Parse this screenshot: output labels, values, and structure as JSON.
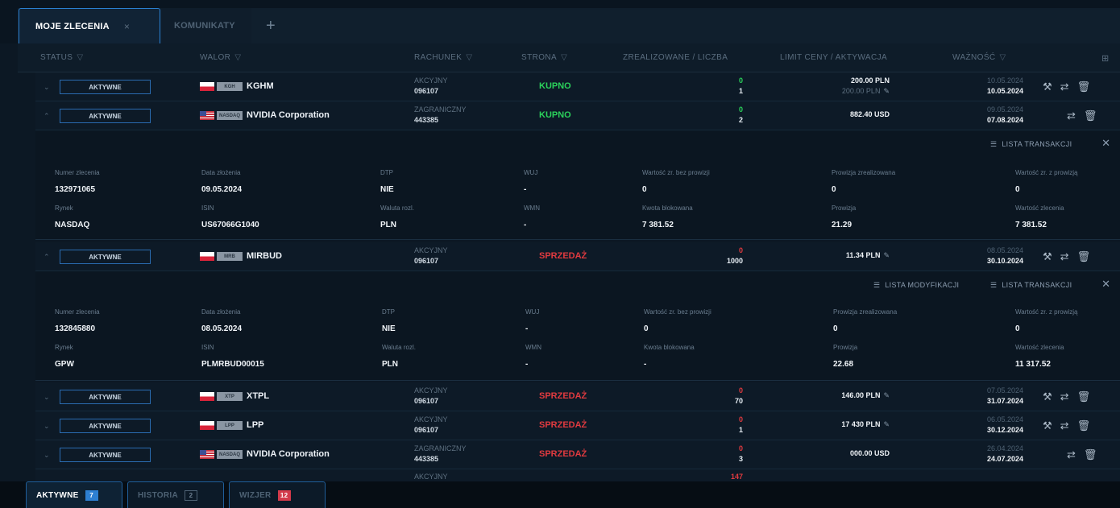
{
  "top_tabs": {
    "active": "MOJE ZLECENIA",
    "close": "×",
    "second": "KOMUNIKATY",
    "plus": "+"
  },
  "columns": {
    "status": "STATUS",
    "walor": "WALOR",
    "rachunek": "RACHUNEK",
    "strona": "STRONA",
    "zrealizowane": "ZREALIZOWANE / LICZBA",
    "limit": "LIMIT CENY / AKTYWACJA",
    "waznosc": "WAŻNOŚĆ",
    "filter_icon": "▽"
  },
  "rows": [
    {
      "status": "AKTYWNE",
      "market": "KGH",
      "name": "KGHM",
      "acc_type": "AKCYJNY",
      "acc_no": "096107",
      "side": "KUPNO",
      "done": "0",
      "qty": "1",
      "limit": "200.00 PLN",
      "limit_sub": "200.00 PLN",
      "valid_from": "10.05.2024",
      "valid_to": "10.05.2024"
    },
    {
      "status": "AKTYWNE",
      "market": "NASDAQ",
      "name": "NVIDIA Corporation",
      "acc_type": "ZAGRANICZNY",
      "acc_no": "443385",
      "side": "KUPNO",
      "done": "0",
      "qty": "2",
      "limit": "882.40 USD",
      "limit_sub": "",
      "valid_from": "09.05.2024",
      "valid_to": "07.08.2024"
    },
    {
      "status": "AKTYWNE",
      "market": "MRB",
      "name": "MIRBUD",
      "acc_type": "AKCYJNY",
      "acc_no": "096107",
      "side": "SPRZEDAŻ",
      "done": "0",
      "qty": "1000",
      "limit": "11.34 PLN",
      "limit_sub": "",
      "valid_from": "08.05.2024",
      "valid_to": "30.10.2024"
    },
    {
      "status": "AKTYWNE",
      "market": "XTP",
      "name": "XTPL",
      "acc_type": "AKCYJNY",
      "acc_no": "096107",
      "side": "SPRZEDAŻ",
      "done": "0",
      "qty": "70",
      "limit": "146.00 PLN",
      "limit_sub": "",
      "valid_from": "07.05.2024",
      "valid_to": "31.07.2024"
    },
    {
      "status": "AKTYWNE",
      "market": "LPP",
      "name": "LPP",
      "acc_type": "AKCYJNY",
      "acc_no": "096107",
      "side": "SPRZEDAŻ",
      "done": "0",
      "qty": "1",
      "limit": "17 430 PLN",
      "limit_sub": "",
      "valid_from": "06.05.2024",
      "valid_to": "30.12.2024"
    },
    {
      "status": "AKTYWNE",
      "market": "NASDAQ",
      "name": "NVIDIA Corporation",
      "acc_type": "ZAGRANICZNY",
      "acc_no": "443385",
      "side": "SPRZEDAŻ",
      "done": "0",
      "qty": "3",
      "limit": "000.00 USD",
      "limit_sub": "",
      "valid_from": "26.04.2024",
      "valid_to": "24.07.2024"
    },
    {
      "acc_type": "AKCYJNY",
      "done": "147"
    }
  ],
  "details": [
    {
      "lista_mod": "",
      "lista_tr": "LISTA TRANSAKCJI",
      "h1": [
        "Numer zlecenia",
        "Data złożenia",
        "DTP",
        "WUJ",
        "Wartość zr. bez prowizji",
        "Prowizja zrealizowana",
        "Wartość zr. z prowizją"
      ],
      "v1": [
        "132971065",
        "09.05.2024",
        "NIE",
        "-",
        "0",
        "0",
        "0"
      ],
      "h2": [
        "Rynek",
        "ISIN",
        "Waluta rozl.",
        "WMN",
        "Kwota blokowana",
        "Prowizja",
        "Wartość zlecenia"
      ],
      "v2": [
        "NASDAQ",
        "US67066G1040",
        "PLN",
        "-",
        "7 381.52",
        "21.29",
        "7 381.52"
      ]
    },
    {
      "lista_mod": "LISTA MODYFIKACJI",
      "lista_tr": "LISTA TRANSAKCJI",
      "h1": [
        "Numer zlecenia",
        "Data złożenia",
        "DTP",
        "WUJ",
        "Wartość zr. bez prowizji",
        "Prowizja zrealizowana",
        "Wartość zr. z prowizją"
      ],
      "v1": [
        "132845880",
        "08.05.2024",
        "NIE",
        "-",
        "0",
        "0",
        "0"
      ],
      "h2": [
        "Rynek",
        "ISIN",
        "Waluta rozl.",
        "WMN",
        "Kwota blokowana",
        "Prowizja",
        "Wartość zlecenia"
      ],
      "v2": [
        "GPW",
        "PLMRBUD00015",
        "PLN",
        "-",
        "-",
        "22.68",
        "11 317.52"
      ]
    }
  ],
  "bottom_tabs": [
    {
      "label": "AKTYWNE",
      "count": "7"
    },
    {
      "label": "HISTORIA",
      "count": "2"
    },
    {
      "label": "WIZJER",
      "count": "12"
    }
  ],
  "icons": [
    "wrench-icon",
    "replace-icon",
    "trash-icon",
    "pencil-icon",
    "list-icon",
    "close-icon",
    "columns-icon"
  ]
}
